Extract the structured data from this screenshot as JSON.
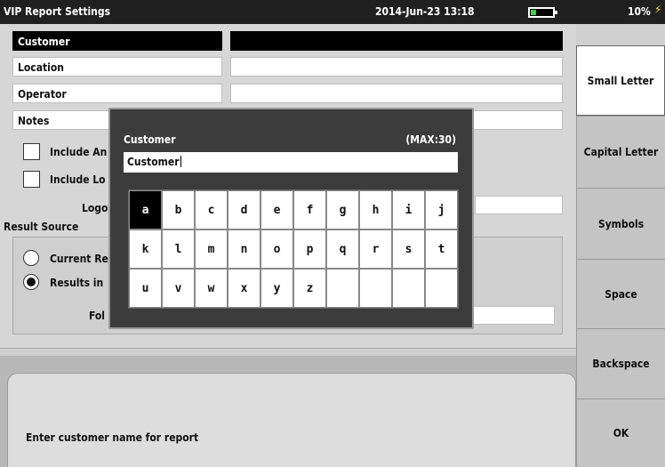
{
  "titlebar": {
    "title": "VIP Report Settings",
    "datetime": "2014-Jun-23 13:18",
    "battery_percent": "10%",
    "battery_level": 0.1
  },
  "form": {
    "fields": [
      {
        "label": "Customer",
        "value": "",
        "selected": true
      },
      {
        "label": "Location",
        "value": ""
      },
      {
        "label": "Operator",
        "value": ""
      },
      {
        "label": "Notes",
        "value": ""
      }
    ],
    "include_an_label": "Include An",
    "include_lo_label": "Include Lo",
    "logo_label": "Logo",
    "result_source_label": "Result Source",
    "current_re_label": "Current Re",
    "results_in_label": "Results in",
    "folder_label": "Fol"
  },
  "dialog": {
    "title": "Customer",
    "max_label": "(MAX:30)",
    "input_value": "Customer",
    "keys": [
      "a",
      "b",
      "c",
      "d",
      "e",
      "f",
      "g",
      "h",
      "i",
      "j",
      "k",
      "l",
      "m",
      "n",
      "o",
      "p",
      "q",
      "r",
      "s",
      "t",
      "u",
      "v",
      "w",
      "x",
      "y",
      "z",
      "",
      "",
      "",
      ""
    ],
    "active_key": "a"
  },
  "sidebar": {
    "buttons": [
      "Small Letter",
      "Capital Letter",
      "Symbols",
      "Space",
      "Backspace",
      "OK"
    ]
  },
  "status": {
    "text": "Enter customer name for report"
  }
}
